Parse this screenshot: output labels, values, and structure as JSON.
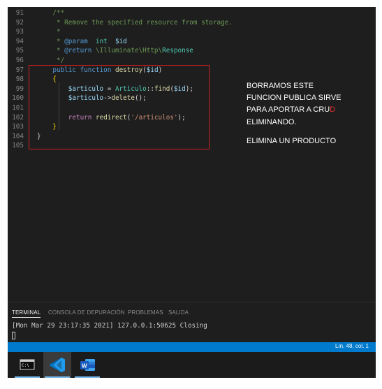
{
  "editor": {
    "lines": [
      {
        "n": "91",
        "segs": [
          {
            "t": "    ",
            "c": "plain"
          },
          {
            "t": "/**",
            "c": "comment"
          }
        ]
      },
      {
        "n": "92",
        "segs": [
          {
            "t": "     * Remove the specified resource from storage.",
            "c": "comment"
          }
        ]
      },
      {
        "n": "93",
        "segs": [
          {
            "t": "     *",
            "c": "comment"
          }
        ]
      },
      {
        "n": "94",
        "segs": [
          {
            "t": "     * ",
            "c": "comment"
          },
          {
            "t": "@param",
            "c": "keyword"
          },
          {
            "t": "  ",
            "c": "comment"
          },
          {
            "t": "int",
            "c": "class"
          },
          {
            "t": "  ",
            "c": "comment"
          },
          {
            "t": "$id",
            "c": "var"
          }
        ]
      },
      {
        "n": "95",
        "segs": [
          {
            "t": "     * ",
            "c": "comment"
          },
          {
            "t": "@return",
            "c": "keyword"
          },
          {
            "t": " \\Illuminate\\Http\\",
            "c": "comment"
          },
          {
            "t": "Response",
            "c": "class"
          }
        ]
      },
      {
        "n": "96",
        "segs": [
          {
            "t": "     */",
            "c": "comment"
          }
        ]
      },
      {
        "n": "97",
        "segs": [
          {
            "t": "    ",
            "c": "plain"
          },
          {
            "t": "public",
            "c": "keyword"
          },
          {
            "t": " ",
            "c": "plain"
          },
          {
            "t": "function",
            "c": "keyword"
          },
          {
            "t": " ",
            "c": "plain"
          },
          {
            "t": "destroy",
            "c": "func"
          },
          {
            "t": "(",
            "c": "plain"
          },
          {
            "t": "$id",
            "c": "var"
          },
          {
            "t": ")",
            "c": "plain"
          }
        ]
      },
      {
        "n": "98",
        "segs": [
          {
            "t": "    ",
            "c": "plain"
          },
          {
            "t": "{",
            "c": "brace"
          }
        ]
      },
      {
        "n": "99",
        "segs": [
          {
            "t": "        ",
            "c": "plain"
          },
          {
            "t": "$articulo",
            "c": "var"
          },
          {
            "t": " = ",
            "c": "plain"
          },
          {
            "t": "Articulo",
            "c": "class"
          },
          {
            "t": "::",
            "c": "plain"
          },
          {
            "t": "find",
            "c": "func"
          },
          {
            "t": "(",
            "c": "plain"
          },
          {
            "t": "$id",
            "c": "var"
          },
          {
            "t": ");",
            "c": "plain"
          }
        ]
      },
      {
        "n": "100",
        "segs": [
          {
            "t": "        ",
            "c": "plain"
          },
          {
            "t": "$articulo",
            "c": "var"
          },
          {
            "t": "->",
            "c": "plain"
          },
          {
            "t": "delete",
            "c": "func"
          },
          {
            "t": "();",
            "c": "plain"
          }
        ]
      },
      {
        "n": "101",
        "segs": []
      },
      {
        "n": "102",
        "segs": [
          {
            "t": "        ",
            "c": "plain"
          },
          {
            "t": "return",
            "c": "kw2"
          },
          {
            "t": " ",
            "c": "plain"
          },
          {
            "t": "redirect",
            "c": "func"
          },
          {
            "t": "(",
            "c": "plain"
          },
          {
            "t": "'/articulos'",
            "c": "str"
          },
          {
            "t": ");",
            "c": "plain"
          }
        ]
      },
      {
        "n": "103",
        "segs": [
          {
            "t": "    ",
            "c": "plain"
          },
          {
            "t": "}",
            "c": "brace"
          }
        ]
      },
      {
        "n": "104",
        "segs": [
          {
            "t": "}",
            "c": "plain"
          }
        ]
      },
      {
        "n": "105",
        "segs": []
      }
    ]
  },
  "annotation": {
    "line1": "BORRAMOS ESTE",
    "line2": "FUNCION PUBLICA SIRVE",
    "line3_pre": "PARA APORTAR A CRU",
    "line3_red": "D",
    "line4": "ELIMINANDO.",
    "line5": "ELIMINA UN PRODUCTO"
  },
  "panel": {
    "tabs": [
      "TERMINAL",
      "CONSOLA DE DEPURACIÓN",
      "PROBLEMAS",
      "SALIDA"
    ],
    "terminal_output": "[Mon Mar 29 23:17:35 2021] 127.0.0.1:50625 Closing"
  },
  "statusbar": {
    "position": "Lín. 48, col. 1"
  },
  "taskbar": {
    "apps": [
      {
        "name": "terminal-icon",
        "active": false
      },
      {
        "name": "vscode-icon",
        "active": true
      },
      {
        "name": "word-icon",
        "active": false
      }
    ]
  },
  "colors": {
    "editor_bg": "#1e1e1e",
    "statusbar": "#007acc",
    "highlight_border": "#d32020"
  }
}
